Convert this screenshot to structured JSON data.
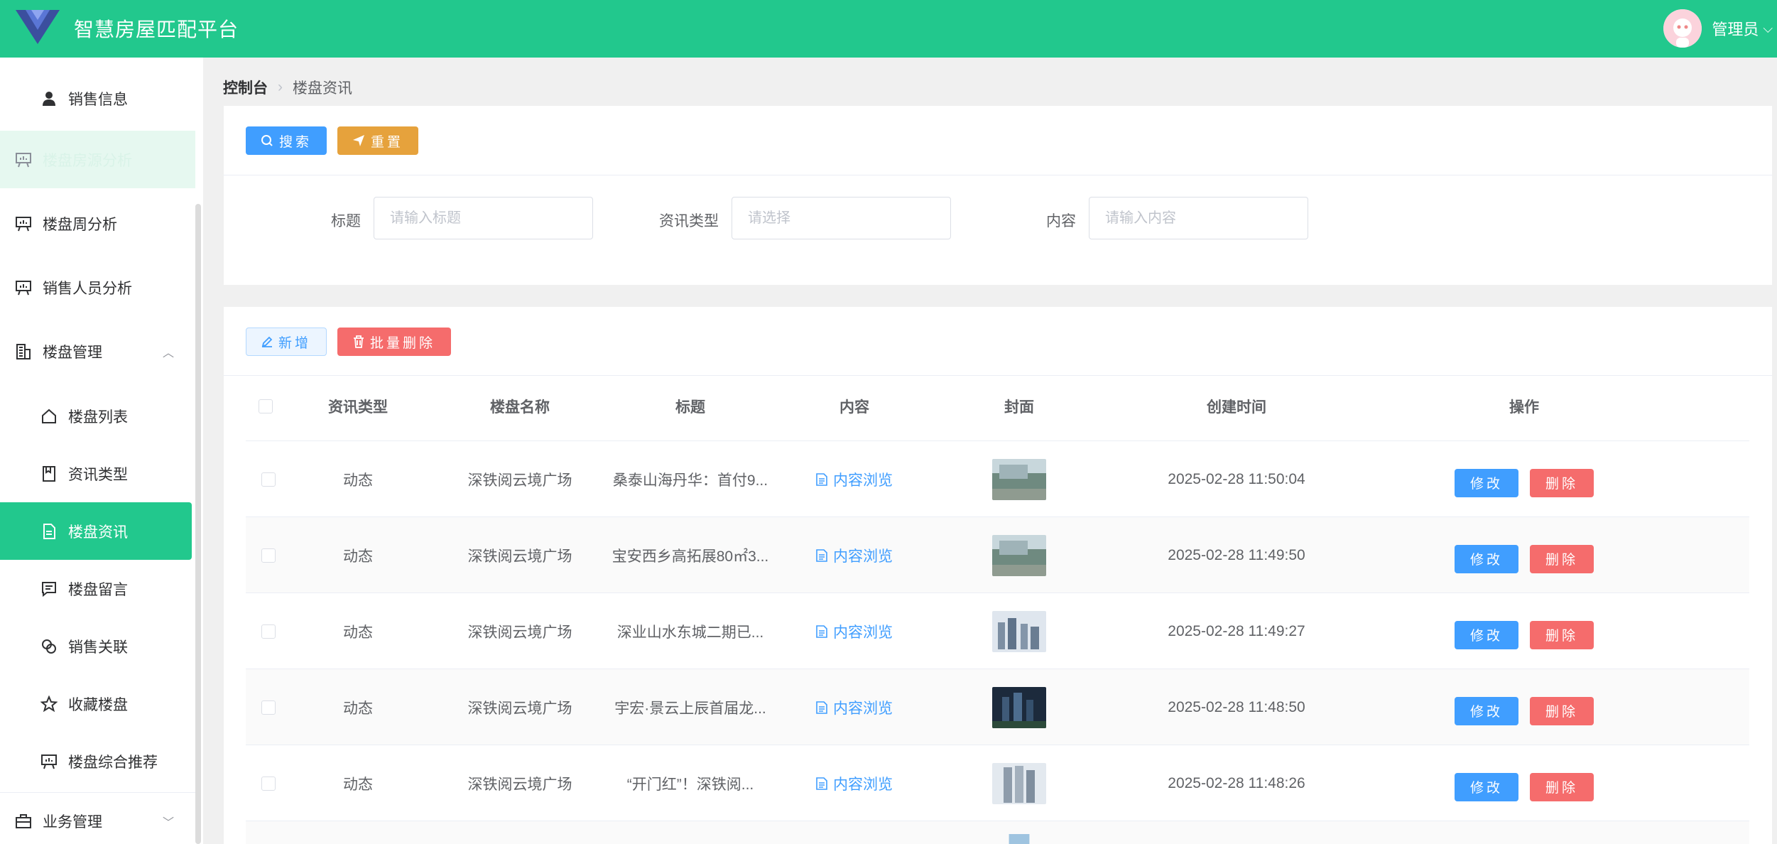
{
  "app": {
    "title": "智慧房屋匹配平台"
  },
  "user": {
    "name": "管理员"
  },
  "sidebar": {
    "items": [
      {
        "label": "销售信息"
      },
      {
        "label": "楼盘房源分析"
      },
      {
        "label": "楼盘周分析"
      },
      {
        "label": "销售人员分析"
      },
      {
        "label": "楼盘管理"
      },
      {
        "label": "楼盘列表"
      },
      {
        "label": "资讯类型"
      },
      {
        "label": "楼盘资讯"
      },
      {
        "label": "楼盘留言"
      },
      {
        "label": "销售关联"
      },
      {
        "label": "收藏楼盘"
      },
      {
        "label": "楼盘综合推荐"
      },
      {
        "label": "业务管理"
      }
    ]
  },
  "breadcrumb": {
    "root": "控制台",
    "current": "楼盘资讯"
  },
  "search": {
    "search_label": "搜索",
    "reset_label": "重置",
    "title_label": "标题",
    "title_placeholder": "请输入标题",
    "type_label": "资讯类型",
    "type_placeholder": "请选择",
    "content_label": "内容",
    "content_placeholder": "请输入内容"
  },
  "toolbar": {
    "add_label": "新增",
    "batch_delete_label": "批量删除"
  },
  "table": {
    "headers": {
      "type": "资讯类型",
      "building": "楼盘名称",
      "title": "标题",
      "content": "内容",
      "cover": "封面",
      "created": "创建时间",
      "actions": "操作"
    },
    "edit_label": "修改",
    "delete_label": "删除",
    "rows": [
      {
        "type": "动态",
        "building": "深铁阅云境广场",
        "title": "桑泰山海丹华：首付9...",
        "content": "内容浏览",
        "created": "2025-02-28 11:50:04"
      },
      {
        "type": "动态",
        "building": "深铁阅云境广场",
        "title": "宝安西乡高拓展80㎡3...",
        "content": "内容浏览",
        "created": "2025-02-28 11:49:50"
      },
      {
        "type": "动态",
        "building": "深铁阅云境广场",
        "title": "深业山水东城二期已...",
        "content": "内容浏览",
        "created": "2025-02-28 11:49:27"
      },
      {
        "type": "动态",
        "building": "深铁阅云境广场",
        "title": "宇宏·景云上辰首届龙...",
        "content": "内容浏览",
        "created": "2025-02-28 11:48:50"
      },
      {
        "type": "动态",
        "building": "深铁阅云境广场",
        "title": "“开门红”！深铁阅...",
        "content": "内容浏览",
        "created": "2025-02-28 11:48:26"
      }
    ]
  },
  "colors": {
    "primary": "#22c88d",
    "blue": "#409eff",
    "orange": "#e6a23c",
    "red": "#f56c6c"
  }
}
